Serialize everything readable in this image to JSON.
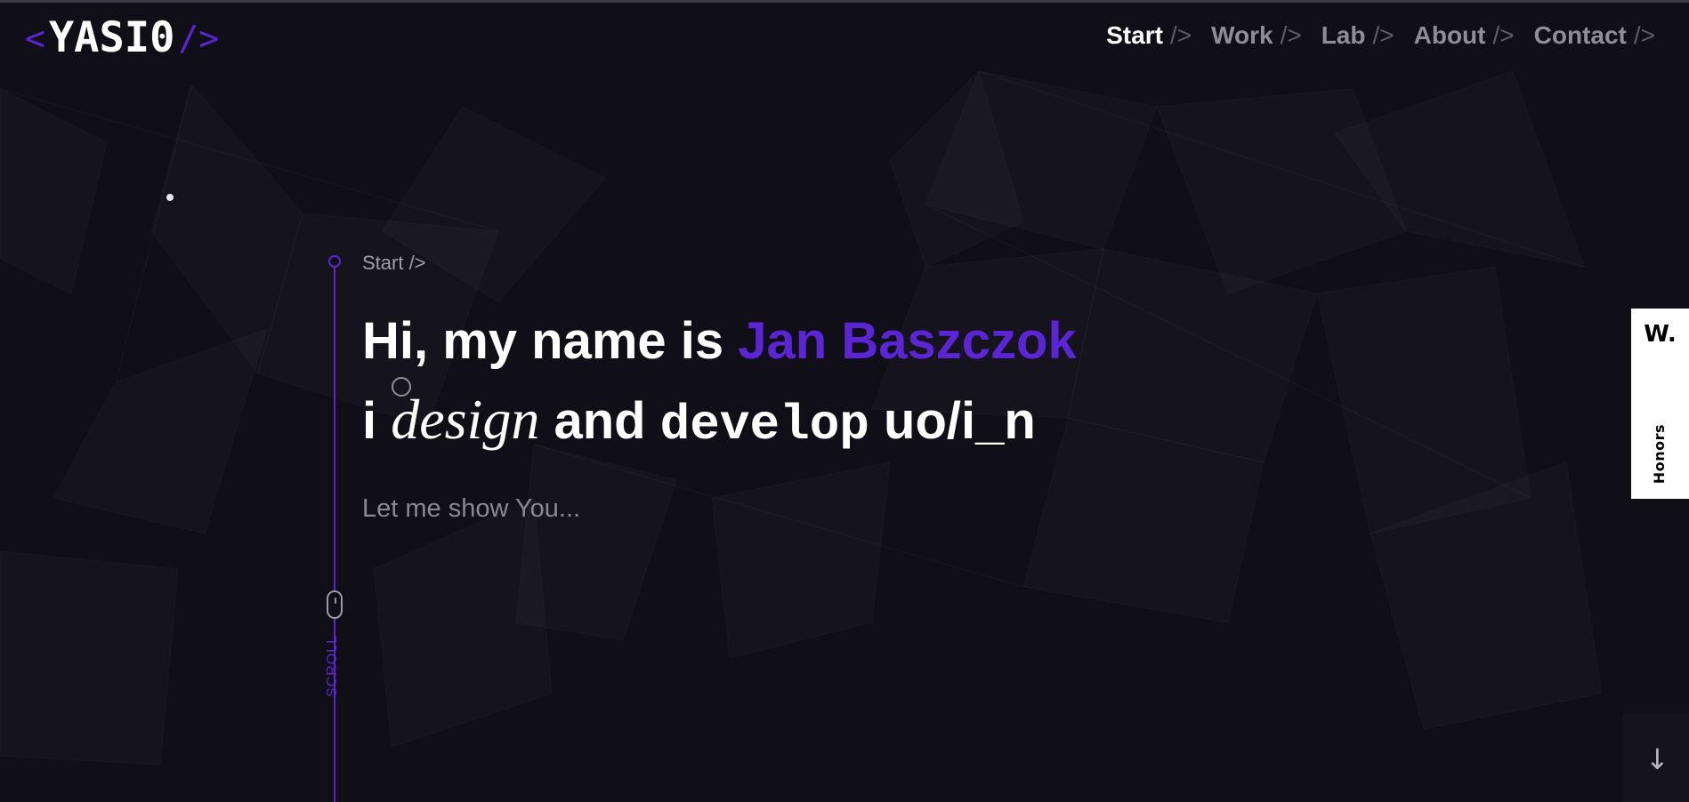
{
  "logo": {
    "open_bracket": "<",
    "name": "YASI0",
    "close_bracket": "/>"
  },
  "nav": {
    "items": [
      {
        "label": "Start",
        "suffix": "/>",
        "active": true
      },
      {
        "label": "Work",
        "suffix": "/>"
      },
      {
        "label": "Lab",
        "suffix": "/>"
      },
      {
        "label": "About",
        "suffix": "/>"
      },
      {
        "label": "Contact",
        "suffix": "/>"
      }
    ]
  },
  "hero": {
    "section_label": "Start />",
    "greeting": "Hi, my name is ",
    "name": "Jan Baszczok",
    "line2_prefix": "i ",
    "line2_design": "design",
    "line2_and": " and ",
    "line2_develop": "develop",
    "line2_suffix": " uo/i_n",
    "subtitle": "Let me show You..."
  },
  "scroll": {
    "label": "SCROLL"
  },
  "honors": {
    "logo_text": "W.",
    "label": "Honors"
  },
  "down_arrow": {
    "glyph": "↓"
  },
  "colors": {
    "background": "#100f18",
    "accent": "#5b25d6",
    "text": "#ffffff",
    "muted": "#8f8d96"
  }
}
